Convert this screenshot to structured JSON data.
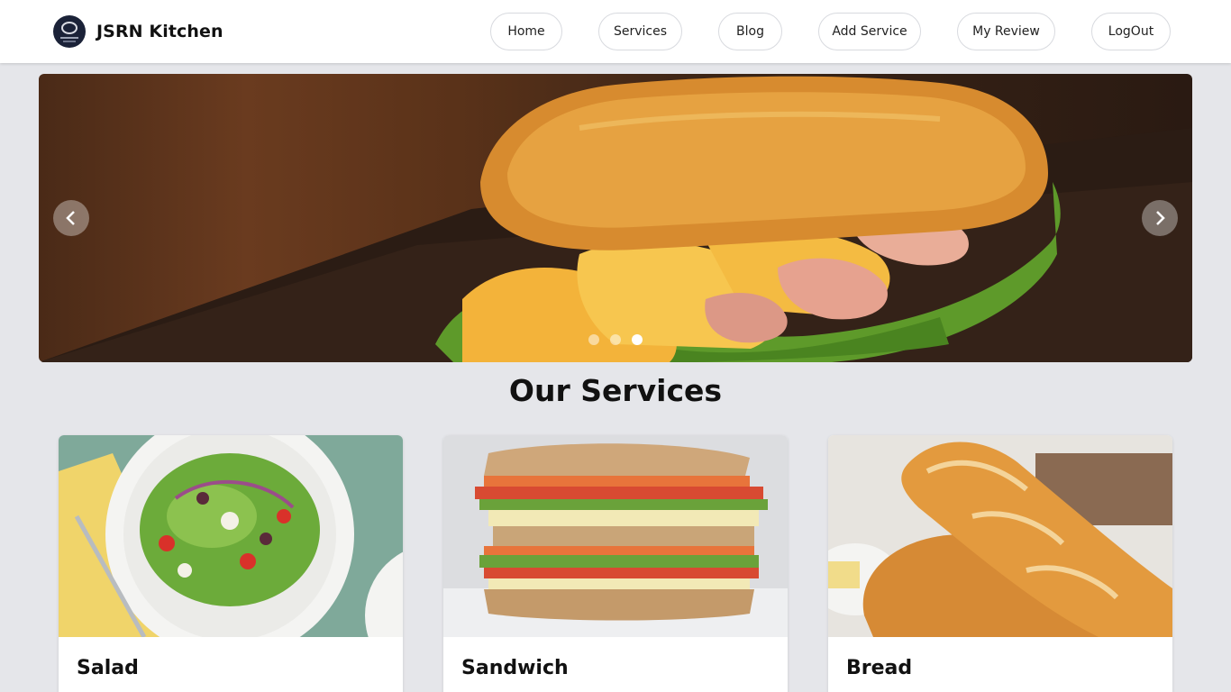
{
  "navbar": {
    "brand": "JSRN Kitchen",
    "links": [
      "Home",
      "Services",
      "Blog",
      "Add Service",
      "My Review",
      "LogOut"
    ]
  },
  "carousel": {
    "prev_icon": "chevron-left-icon",
    "next_icon": "chevron-right-icon",
    "slide_count": 3,
    "active_slide": 3
  },
  "services": {
    "title": "Our Services",
    "cards": [
      {
        "title": "Salad"
      },
      {
        "title": "Sandwich"
      },
      {
        "title": "Bread"
      }
    ]
  },
  "colors": {
    "background": "#e5e6ea",
    "navbar": "#ffffff",
    "text": "#111111"
  }
}
